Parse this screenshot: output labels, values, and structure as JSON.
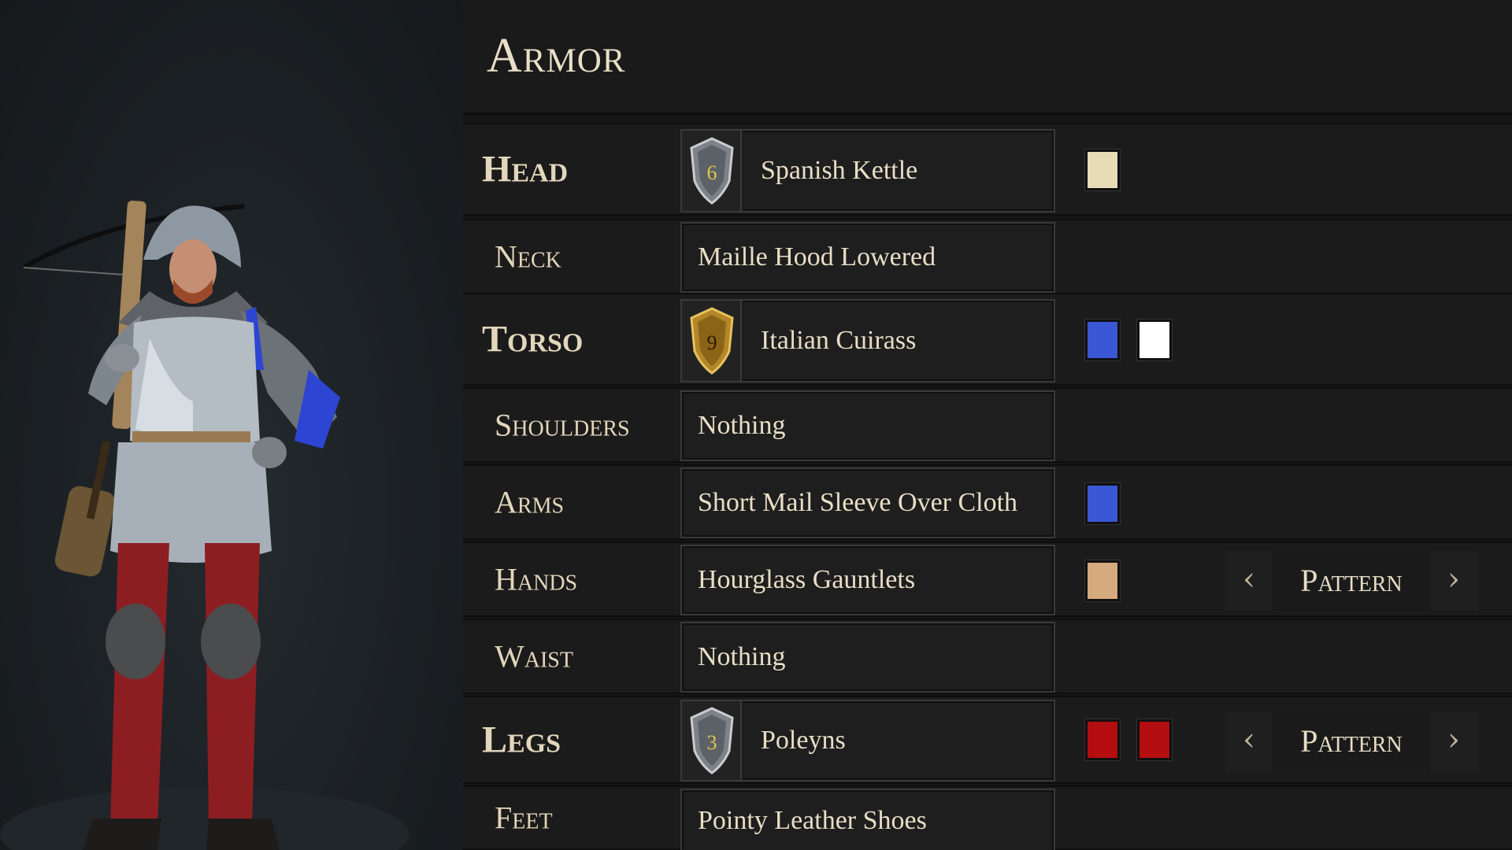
{
  "panel": {
    "title": "Armor"
  },
  "slots": [
    {
      "label": "Head",
      "item": "Spanish Kettle",
      "rating": "6",
      "tier": "silver",
      "colors": [
        "#e6dcb6"
      ]
    },
    {
      "label": "Neck",
      "item": "Maille Hood Lowered"
    },
    {
      "label": "Torso",
      "item": "Italian Cuirass",
      "rating": "9",
      "tier": "gold",
      "colors": [
        "#3a57d6",
        "#ffffff"
      ]
    },
    {
      "label": "Shoulders",
      "item": "Nothing"
    },
    {
      "label": "Arms",
      "item": "Short Mail Sleeve Over Cloth",
      "colors": [
        "#3a57d6"
      ]
    },
    {
      "label": "Hands",
      "item": "Hourglass Gauntlets",
      "colors": [
        "#d5aa7e"
      ],
      "pattern": "Pattern"
    },
    {
      "label": "Waist",
      "item": "Nothing"
    },
    {
      "label": "Legs",
      "item": "Poleyns",
      "rating": "3",
      "tier": "silver",
      "colors": [
        "#b30d10",
        "#b30d10"
      ],
      "pattern": "Pattern"
    },
    {
      "label": "Feet",
      "item": "Pointy Leather Shoes"
    }
  ],
  "icons": {
    "shield": "shield-rating-icon",
    "prev": "chevron-left-icon",
    "next": "chevron-right-icon",
    "left_glyph": "‹",
    "right_glyph": "›"
  },
  "preview": {
    "character": "crossbowman-character-model"
  }
}
